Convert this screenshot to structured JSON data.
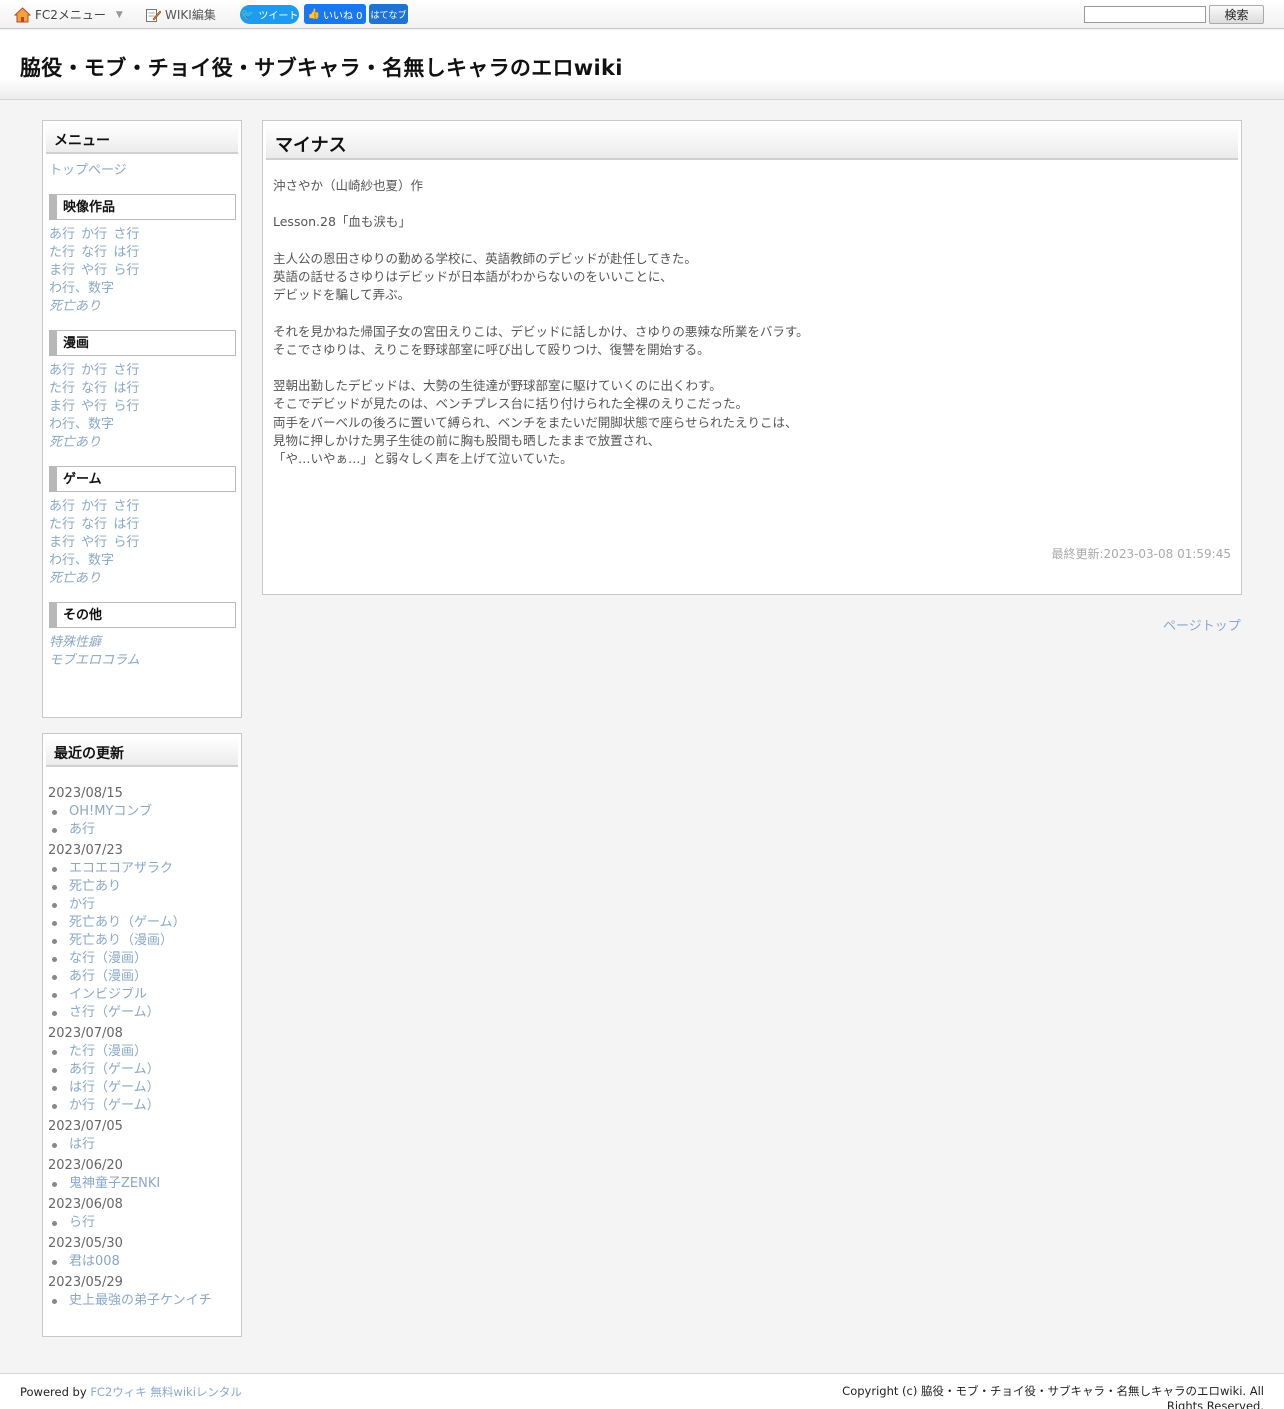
{
  "topbar": {
    "fc2_menu": "FC2メニュー",
    "wiki_edit": "WIKI編集",
    "tweet": "ツイート",
    "like": "いいね 0",
    "hatena": "はてなブ",
    "search_value": "",
    "search_button": "検索"
  },
  "header": {
    "title": "脇役・モブ・チョイ役・サブキャラ・名無しキャラのエロwiki"
  },
  "menu": {
    "heading": "メニュー",
    "top_page": "トップページ",
    "sections": [
      {
        "title": "映像作品",
        "rows": [
          [
            "あ行",
            "か行",
            "さ行"
          ],
          [
            "た行",
            "な行",
            "は行"
          ],
          [
            "ま行",
            "や行",
            "ら行"
          ],
          [
            "わ行、数字"
          ]
        ],
        "special": "死亡あり"
      },
      {
        "title": "漫画",
        "rows": [
          [
            "あ行",
            "か行",
            "さ行"
          ],
          [
            "た行",
            "な行",
            "は行"
          ],
          [
            "ま行",
            "や行",
            "ら行"
          ],
          [
            "わ行、数字"
          ]
        ],
        "special": "死亡あり"
      },
      {
        "title": "ゲーム",
        "rows": [
          [
            "あ行",
            "か行",
            "さ行"
          ],
          [
            "た行",
            "な行",
            "は行"
          ],
          [
            "ま行",
            "や行",
            "ら行"
          ],
          [
            "わ行、数字"
          ]
        ],
        "special": "死亡あり"
      }
    ],
    "other": {
      "title": "その他",
      "links": [
        "特殊性癖",
        "モブエロコラム"
      ]
    }
  },
  "recent": {
    "heading": "最近の更新",
    "groups": [
      {
        "date": "2023/08/15",
        "items": [
          "OH!MYコンブ",
          "あ行"
        ]
      },
      {
        "date": "2023/07/23",
        "items": [
          "エコエコアザラク",
          "死亡あり",
          "か行",
          "死亡あり（ゲーム）",
          "死亡あり（漫画）",
          "な行（漫画）",
          "あ行（漫画）",
          "インビジブル",
          "さ行（ゲーム）"
        ]
      },
      {
        "date": "2023/07/08",
        "items": [
          "た行（漫画）",
          "あ行（ゲーム）",
          "は行（ゲーム）",
          "か行（ゲーム）"
        ]
      },
      {
        "date": "2023/07/05",
        "items": [
          "は行"
        ]
      },
      {
        "date": "2023/06/20",
        "items": [
          "鬼神童子ZENKI"
        ]
      },
      {
        "date": "2023/06/08",
        "items": [
          "ら行"
        ]
      },
      {
        "date": "2023/05/30",
        "items": [
          "君は008"
        ]
      },
      {
        "date": "2023/05/29",
        "items": [
          "史上最強の弟子ケンイチ"
        ]
      }
    ]
  },
  "article": {
    "title": "マイナス",
    "paragraphs": [
      [
        "沖さやか（山崎紗也夏）作"
      ],
      [
        "Lesson.28「血も涙も」"
      ],
      [
        "主人公の恩田さゆりの勤める学校に、英語教師のデビッドが赴任してきた。",
        "英語の話せるさゆりはデビッドが日本語がわからないのをいいことに、",
        "デビッドを騙して弄ぶ。"
      ],
      [
        "それを見かねた帰国子女の宮田えりこは、デビッドに話しかけ、さゆりの悪辣な所業をバラす。",
        "そこでさゆりは、えりこを野球部室に呼び出して殴りつけ、復讐を開始する。"
      ],
      [
        "翌朝出勤したデビッドは、大勢の生徒達が野球部室に駆けていくのに出くわす。",
        "そこでデビッドが見たのは、ベンチプレス台に括り付けられた全裸のえりこだった。",
        "両手をバーベルの後ろに置いて縛られ、ベンチをまたいだ開脚状態で座らせられたえりこは、",
        "見物に押しかけた男子生徒の前に胸も股間も晒したままで放置され、",
        "「や…いやぁ…」と弱々しく声を上げて泣いていた。"
      ]
    ],
    "last_update": "最終更新:2023-03-08 01:59:45"
  },
  "page_top": "ページトップ",
  "footer": {
    "powered_prefix": "Powered by ",
    "powered_link": "FC2ウィキ 無料wikiレンタル",
    "copyright": "Copyright (c) 脇役・モブ・チョイ役・サブキャラ・名無しキャラのエロwiki. All Rights Reserved."
  }
}
